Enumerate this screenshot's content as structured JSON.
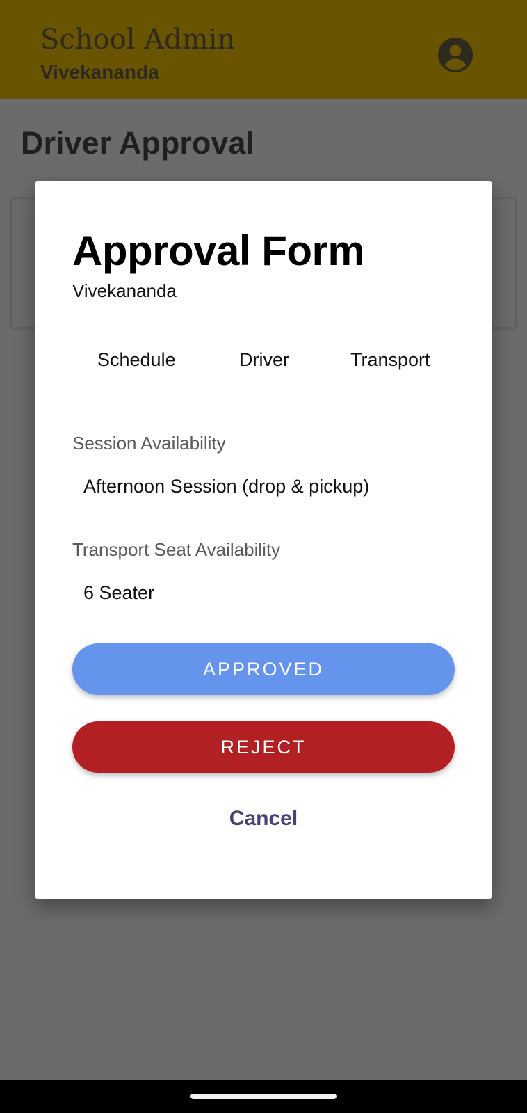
{
  "app_bar": {
    "title": "School Admin",
    "subtitle": "Vivekananda",
    "account_icon": "account-circle-icon",
    "color": "#695501"
  },
  "page": {
    "title": "Driver Approval"
  },
  "dialog": {
    "title": "Approval Form",
    "subtitle": "Vivekananda",
    "tabs": [
      {
        "label": "Schedule"
      },
      {
        "label": "Driver"
      },
      {
        "label": "Transport"
      }
    ],
    "fields": {
      "session": {
        "label": "Session Availability",
        "value": "Afternoon Session (drop & pickup)"
      },
      "seat": {
        "label": "Transport Seat Availability",
        "value": "6 Seater"
      }
    },
    "buttons": {
      "approve": {
        "label": "APPROVED",
        "color": "#6494eb"
      },
      "reject": {
        "label": "REJECT",
        "color": "#b22024"
      },
      "cancel": {
        "label": "Cancel",
        "color": "#474373"
      }
    }
  }
}
